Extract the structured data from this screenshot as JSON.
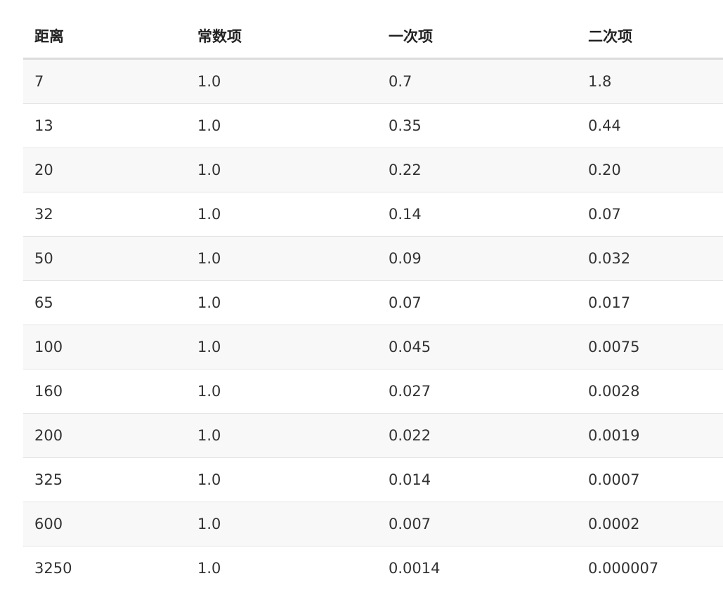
{
  "table": {
    "headers": [
      "距离",
      "常数项",
      "一次项",
      "二次项"
    ],
    "rows": [
      [
        "7",
        "1.0",
        "0.7",
        "1.8"
      ],
      [
        "13",
        "1.0",
        "0.35",
        "0.44"
      ],
      [
        "20",
        "1.0",
        "0.22",
        "0.20"
      ],
      [
        "32",
        "1.0",
        "0.14",
        "0.07"
      ],
      [
        "50",
        "1.0",
        "0.09",
        "0.032"
      ],
      [
        "65",
        "1.0",
        "0.07",
        "0.017"
      ],
      [
        "100",
        "1.0",
        "0.045",
        "0.0075"
      ],
      [
        "160",
        "1.0",
        "0.027",
        "0.0028"
      ],
      [
        "200",
        "1.0",
        "0.022",
        "0.0019"
      ],
      [
        "325",
        "1.0",
        "0.014",
        "0.0007"
      ],
      [
        "600",
        "1.0",
        "0.007",
        "0.0002"
      ],
      [
        "3250",
        "1.0",
        "0.0014",
        "0.000007"
      ]
    ]
  }
}
